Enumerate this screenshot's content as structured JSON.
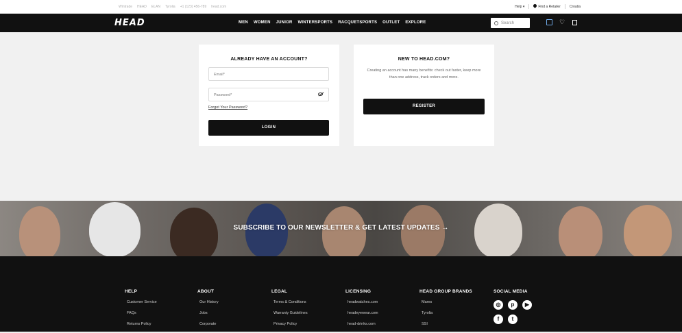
{
  "topbar": {
    "brands": [
      "Wintrade",
      "HEAD",
      "ELAN",
      "Tyrolia",
      "+1 (123) 456-789",
      "head.com"
    ],
    "help": "Help ▾",
    "retailer": "Find a Retailer",
    "country": "Croatia"
  },
  "nav": {
    "logo": "HEAD",
    "links": [
      "MEN",
      "WOMEN",
      "JUNIOR",
      "WINTERSPORTS",
      "RACQUETSPORTS",
      "OUTLET",
      "EXPLORE"
    ],
    "search_placeholder": "Search"
  },
  "login": {
    "title": "ALREADY HAVE AN ACCOUNT?",
    "email_placeholder": "Email*",
    "password_placeholder": "Password*",
    "forgot": "Forgot Your Password?",
    "login_button": "LOGIN"
  },
  "register": {
    "title": "NEW TO HEAD.COM?",
    "text": "Creating an account has many benefits: check out faster, keep more than one address, track orders and more.",
    "register_button": "REGISTER"
  },
  "banner": {
    "title": "SUBSCRIBE TO OUR NEWSLETTER & GET LATEST UPDATES →"
  },
  "footer": {
    "columns": [
      {
        "title": "HELP",
        "links": [
          "Customer Service",
          "FAQs",
          "Returns Policy"
        ]
      },
      {
        "title": "ABOUT",
        "links": [
          "Our History",
          "Jobs",
          "Corporate"
        ]
      },
      {
        "title": "LEGAL",
        "links": [
          "Terms & Conditions",
          "Warranty Guidelines",
          "Privacy Policy"
        ]
      },
      {
        "title": "LICENSING",
        "links": [
          "headwatches.com",
          "headeyewear.com",
          "head-drinks.com"
        ]
      },
      {
        "title": "HEAD GROUP BRANDS",
        "links": [
          "Mares",
          "Tyrolia",
          "SSI"
        ]
      }
    ],
    "social_title": "SOCIAL MEDIA",
    "social_icons": [
      "instagram-icon",
      "pinterest-icon",
      "youtube-icon",
      "facebook-icon",
      "twitter-icon"
    ]
  },
  "colors": {
    "nav_bg": "#111111",
    "page_bg": "#f1f1f1",
    "button_bg": "#111111",
    "footer_bg": "#111111"
  }
}
